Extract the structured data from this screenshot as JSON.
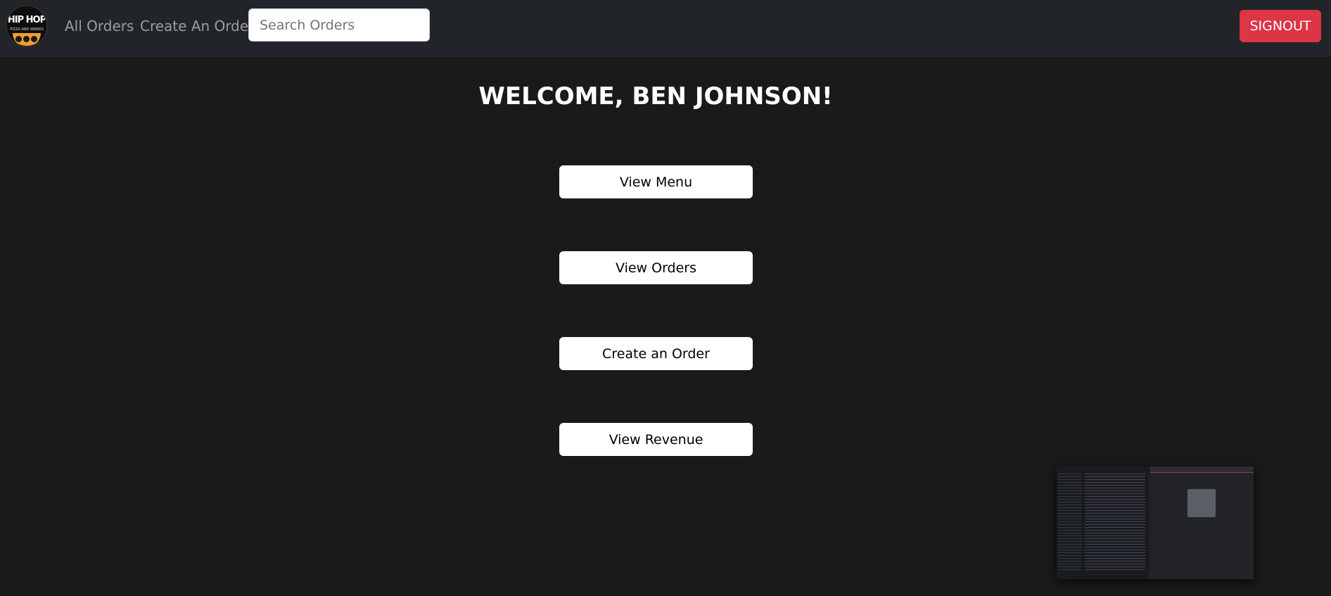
{
  "brand": {
    "logo_top": "HIP HOP",
    "logo_bottom": "PIZZA AND WANGS"
  },
  "nav": {
    "all_orders": "All Orders",
    "create_order": "Create An Order",
    "search_placeholder": "Search Orders",
    "search_value": "",
    "signout": "SIGNOUT"
  },
  "main": {
    "welcome": "WELCOME, BEN JOHNSON!",
    "buttons": [
      {
        "label": "View Menu"
      },
      {
        "label": "View Orders"
      },
      {
        "label": "Create an Order"
      },
      {
        "label": "View Revenue"
      }
    ]
  },
  "colors": {
    "navbar_bg": "#212529",
    "page_bg": "#1a1a1a",
    "signout_bg": "#dc3545",
    "button_bg": "#ffffff"
  }
}
